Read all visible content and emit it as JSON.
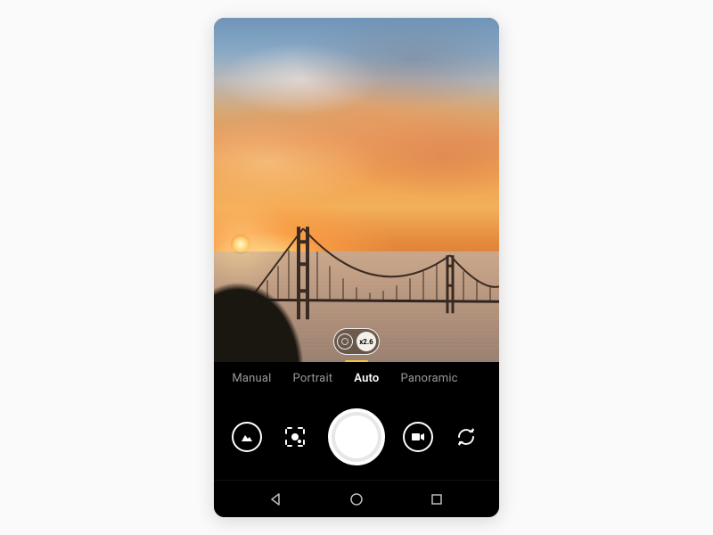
{
  "modes": {
    "items": [
      "Manual",
      "Portrait",
      "Auto",
      "Panoramic"
    ],
    "active_index": 2
  },
  "zoom": {
    "value_label": "x2.6"
  },
  "icons": {
    "gallery": "gallery-icon",
    "lens": "lens-search-icon",
    "shutter": "shutter-icon",
    "video": "video-icon",
    "switch": "switch-camera-icon",
    "nav_back": "nav-back-icon",
    "nav_home": "nav-home-icon",
    "nav_recent": "nav-recent-icon"
  },
  "accent_color": "#f5c63a"
}
